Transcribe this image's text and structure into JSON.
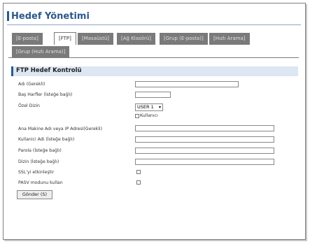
{
  "header": {
    "title": "Hedef Yönetimi"
  },
  "tabs": [
    {
      "label": "[E-posta]"
    },
    {
      "label": "[FTP]"
    },
    {
      "label": "[Masaüstü]"
    },
    {
      "label": "[Ağ Klasörü]"
    },
    {
      "label": "[Grup (E-posta)]"
    },
    {
      "label": "[Hızlı Arama]"
    },
    {
      "label": "[Grup (Hızlı Arama)]"
    }
  ],
  "active_tab": "[FTP]",
  "section": {
    "title": "FTP Hedef Kontrolü"
  },
  "form": {
    "name_label": "Adı (Gerekli)",
    "initials_label": "Baş Harfler (İsteğe bağlı)",
    "custom_dir_label": "Özel Dizin",
    "custom_dir_value": "USER 1",
    "user_checkbox_label": "Kullanıcı",
    "host_label": "Ana Makine Adı veya IP Adresi(Gerekli)",
    "username_label": "Kullanici Adi (İsteğe bağlı)",
    "password_label": "Parola (İsteğe bağlı)",
    "directory_label": "Dizin (İsteğe bağlı)",
    "ssl_label": "SSL'yi etkinleştir",
    "pasv_label": "PASV modunu kullan",
    "submit_label": "Gönder (S)"
  },
  "colors": {
    "accent": "#2a5a8c",
    "tab_bg": "#7a7a7a",
    "section_bg": "#dde7f3"
  }
}
